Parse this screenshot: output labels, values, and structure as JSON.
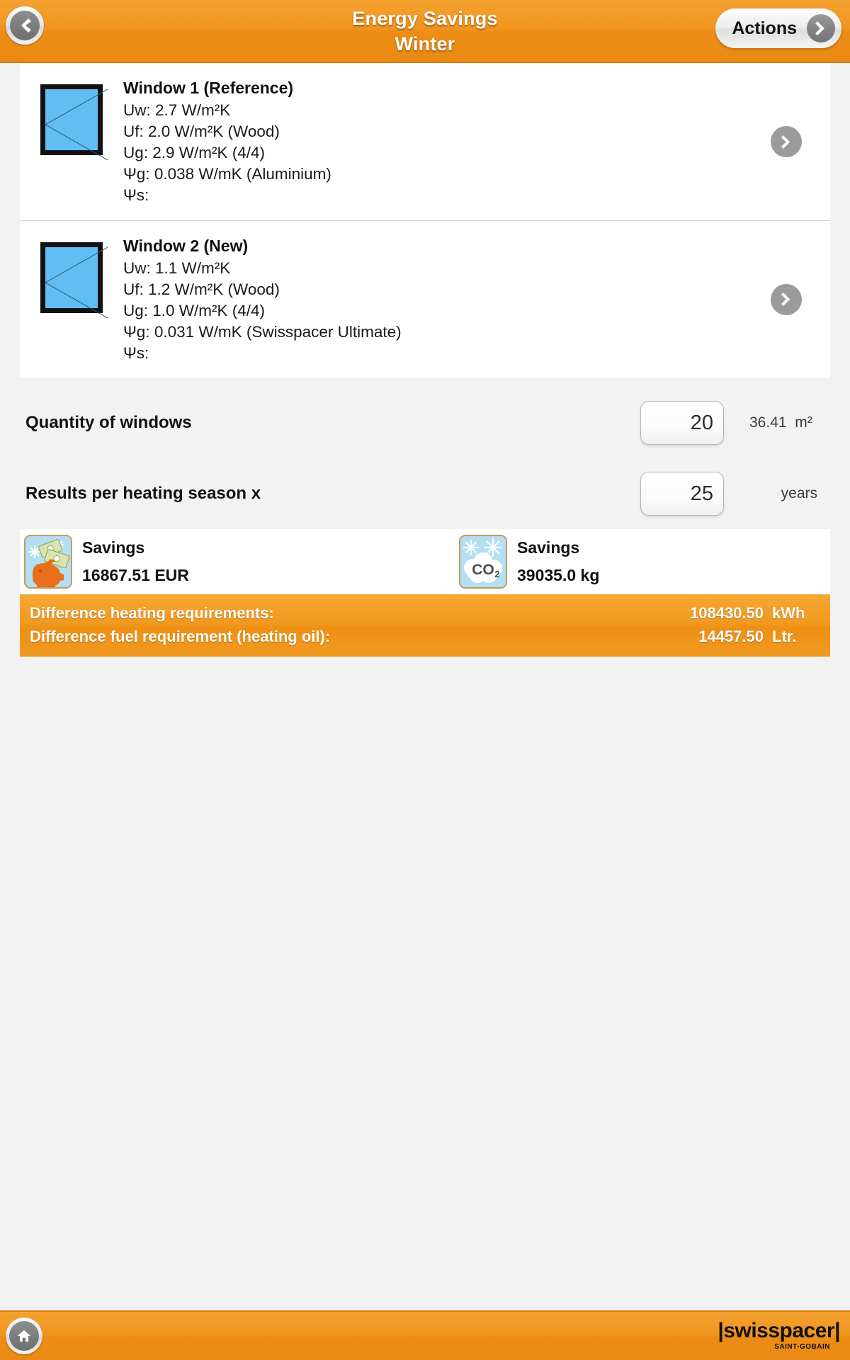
{
  "header": {
    "title_line1": "Energy Savings",
    "title_line2": "Winter",
    "back_icon": "chevron-left-icon",
    "actions_label": "Actions",
    "actions_icon": "chevron-right-icon",
    "accent_color": "#ef9118"
  },
  "windows": [
    {
      "title": "Window 1 (Reference)",
      "uw": "Uw: 2.7 W/m²K",
      "uf": "Uf: 2.0 W/m²K (Wood)",
      "ug": "Ug: 2.9 W/m²K (4/4)",
      "psi_g": "Ψg: 0.038 W/mK (Aluminium)",
      "psi_s": "Ψs:"
    },
    {
      "title": "Window 2 (New)",
      "uw": "Uw: 1.1 W/m²K",
      "uf": "Uf: 1.2 W/m²K (Wood)",
      "ug": "Ug: 1.0 W/m²K (4/4)",
      "psi_g": "Ψg: 0.031 W/mK (Swisspacer Ultimate)",
      "psi_s": "Ψs:"
    }
  ],
  "inputs": {
    "quantity_label": "Quantity of windows",
    "quantity_value": "20",
    "quantity_area": "36.41",
    "quantity_area_unit": "m²",
    "years_label": "Results per heating season x",
    "years_value": "25",
    "years_unit": "years"
  },
  "savings": [
    {
      "icon": "piggy-bank-savings-icon",
      "title": "Savings",
      "value": "16867.51 EUR"
    },
    {
      "icon": "co2-cloud-icon",
      "title": "Savings",
      "value": "39035.0 kg"
    }
  ],
  "difference": [
    {
      "label": "Difference heating requirements:",
      "value": "108430.50",
      "unit": "kWh"
    },
    {
      "label": "Difference fuel requirement (heating oil):",
      "value": "14457.50",
      "unit": "Ltr."
    }
  ],
  "footer": {
    "home_icon": "home-icon",
    "logo_text": "swisspacer",
    "logo_sub": "SAINT-GOBAIN"
  }
}
